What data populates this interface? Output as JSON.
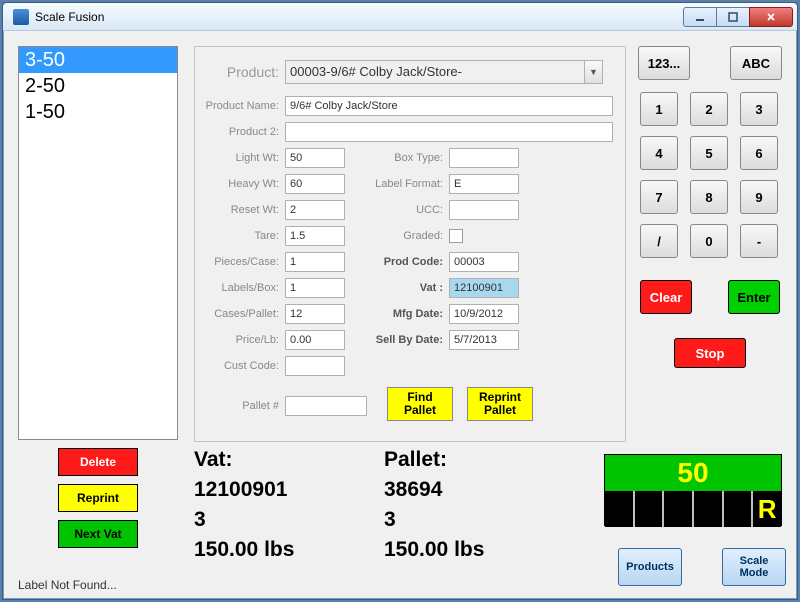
{
  "window": {
    "title": "Scale Fusion"
  },
  "list": {
    "items": [
      "3-50",
      "2-50",
      "1-50"
    ],
    "selected_index": 0
  },
  "left_buttons": {
    "delete": "Delete",
    "reprint": "Reprint",
    "next_vat": "Next Vat"
  },
  "status": "Label Not Found...",
  "form": {
    "product_label": "Product:",
    "product_value": "00003-9/6# Colby Jack/Store-",
    "product_name_label": "Product Name:",
    "product_name": "9/6# Colby Jack/Store",
    "product2_label": "Product 2:",
    "product2": "",
    "light_wt_label": "Light Wt:",
    "light_wt": "50",
    "heavy_wt_label": "Heavy Wt:",
    "heavy_wt": "60",
    "reset_wt_label": "Reset Wt:",
    "reset_wt": "2",
    "tare_label": "Tare:",
    "tare": "1.5",
    "pieces_case_label": "Pieces/Case:",
    "pieces_case": "1",
    "labels_box_label": "Labels/Box:",
    "labels_box": "1",
    "cases_pallet_label": "Cases/Pallet:",
    "cases_pallet": "12",
    "price_lb_label": "Price/Lb:",
    "price_lb": "0.00",
    "cust_code_label": "Cust Code:",
    "cust_code": "",
    "pallet_no_label": "Pallet #",
    "pallet_no": "",
    "box_type_label": "Box Type:",
    "box_type": "",
    "label_format_label": "Label Format:",
    "label_format": "E",
    "ucc_label": "UCC:",
    "ucc": "",
    "graded_label": "Graded:",
    "prod_code_label": "Prod Code:",
    "prod_code": "00003",
    "vat_label": "Vat :",
    "vat": "12100901",
    "mfg_date_label": "Mfg Date:",
    "mfg_date": "10/9/2012",
    "sell_by_label": "Sell By Date:",
    "sell_by": "5/7/2013",
    "find_pallet": "Find\nPallet",
    "reprint_pallet": "Reprint\nPallet"
  },
  "keypad": {
    "num": "123...",
    "abc": "ABC",
    "k1": "1",
    "k2": "2",
    "k3": "3",
    "k4": "4",
    "k5": "5",
    "k6": "6",
    "k7": "7",
    "k8": "8",
    "k9": "9",
    "slash": "/",
    "k0": "0",
    "dash": "-",
    "clear": "Clear",
    "enter": "Enter",
    "stop": "Stop"
  },
  "summary": {
    "vat_label": "Vat:",
    "vat": "12100901",
    "vat_count": "3",
    "vat_weight": "150.00 lbs",
    "pallet_label": "Pallet:",
    "pallet": "38694",
    "pallet_count": "3",
    "pallet_weight": "150.00 lbs"
  },
  "scale": {
    "value": "50",
    "indicator": "R"
  },
  "bottom": {
    "products": "Products",
    "scale_mode": "Scale\nMode"
  }
}
